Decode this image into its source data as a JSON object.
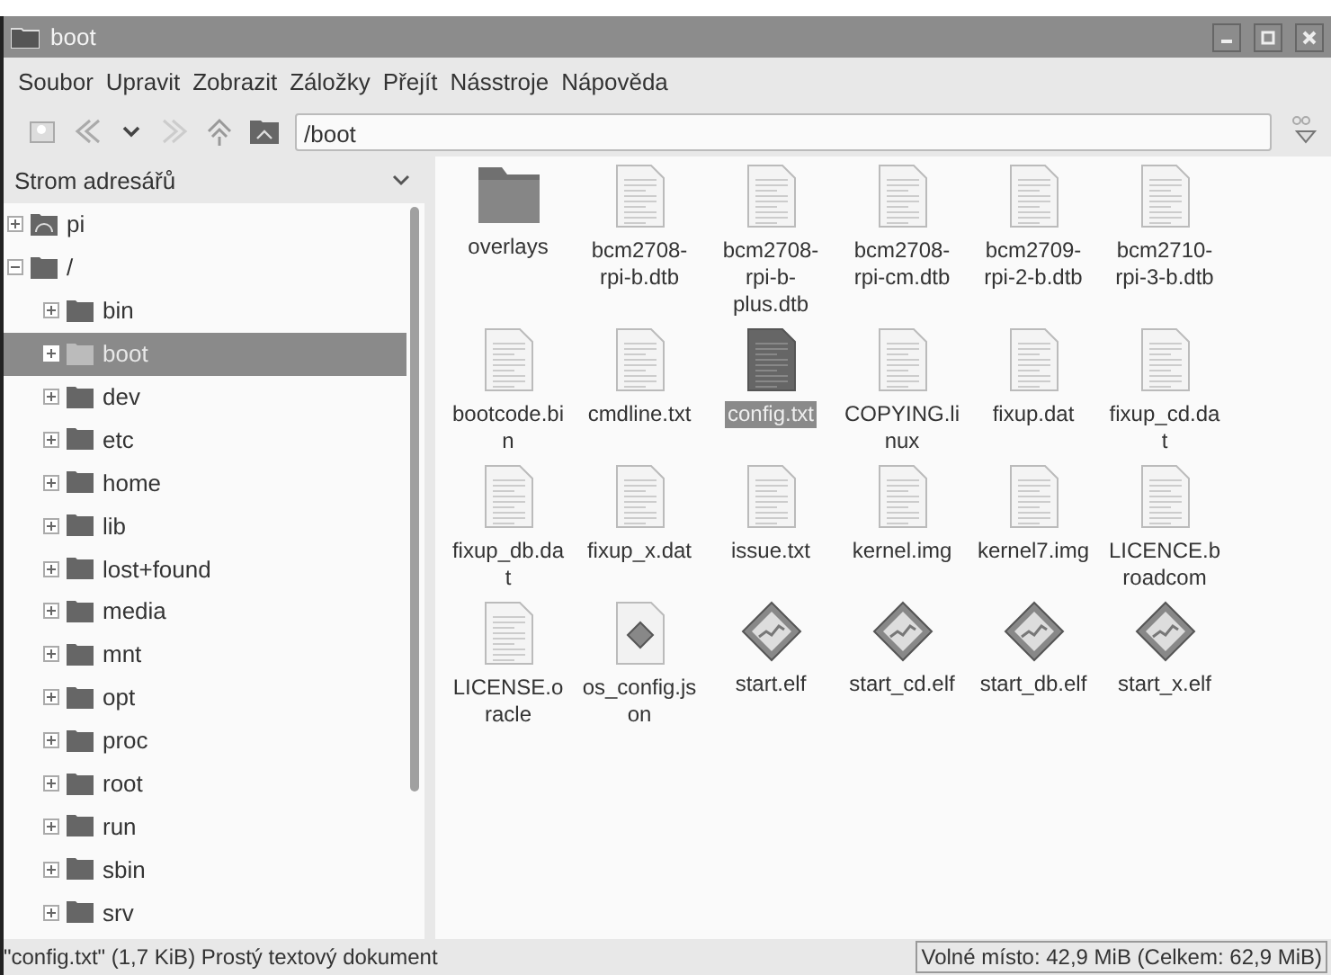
{
  "window": {
    "title": "boot"
  },
  "menu": [
    "Soubor",
    "Upravit",
    "Zobrazit",
    "Záložky",
    "Přejít",
    "Násstroje",
    "Nápověda"
  ],
  "toolbar": {
    "path": "/boot"
  },
  "sidebar": {
    "title": "Strom adresářů",
    "tree": [
      {
        "label": "pi",
        "kind": "home",
        "expanded": false,
        "selected": false
      },
      {
        "label": "/",
        "kind": "folder",
        "expanded": true,
        "selected": false,
        "children": [
          {
            "label": "bin",
            "kind": "folder",
            "expanded": false,
            "selected": false
          },
          {
            "label": "boot",
            "kind": "folder",
            "expanded": false,
            "selected": true
          },
          {
            "label": "dev",
            "kind": "folder",
            "expanded": false,
            "selected": false
          },
          {
            "label": "etc",
            "kind": "folder",
            "expanded": false,
            "selected": false
          },
          {
            "label": "home",
            "kind": "folder",
            "expanded": false,
            "selected": false
          },
          {
            "label": "lib",
            "kind": "folder",
            "expanded": false,
            "selected": false
          },
          {
            "label": "lost+found",
            "kind": "folder",
            "expanded": false,
            "selected": false
          },
          {
            "label": "media",
            "kind": "folder",
            "expanded": false,
            "selected": false
          },
          {
            "label": "mnt",
            "kind": "folder",
            "expanded": false,
            "selected": false
          },
          {
            "label": "opt",
            "kind": "folder",
            "expanded": false,
            "selected": false
          },
          {
            "label": "proc",
            "kind": "folder",
            "expanded": false,
            "selected": false
          },
          {
            "label": "root",
            "kind": "folder",
            "expanded": false,
            "selected": false
          },
          {
            "label": "run",
            "kind": "folder",
            "expanded": false,
            "selected": false
          },
          {
            "label": "sbin",
            "kind": "folder",
            "expanded": false,
            "selected": false
          },
          {
            "label": "srv",
            "kind": "folder",
            "expanded": false,
            "selected": false
          }
        ]
      }
    ]
  },
  "files": [
    {
      "name": "overlays",
      "kind": "folder",
      "selected": false
    },
    {
      "name": "bcm2708-rpi-b.dtb",
      "kind": "text",
      "selected": false
    },
    {
      "name": "bcm2708-rpi-b-plus.dtb",
      "kind": "text",
      "selected": false
    },
    {
      "name": "bcm2708-rpi-cm.dtb",
      "kind": "text",
      "selected": false
    },
    {
      "name": "bcm2709-rpi-2-b.dtb",
      "kind": "text",
      "selected": false
    },
    {
      "name": "bcm2710-rpi-3-b.dtb",
      "kind": "text",
      "selected": false
    },
    {
      "name": "bootcode.bin",
      "kind": "text",
      "selected": false
    },
    {
      "name": "cmdline.txt",
      "kind": "text",
      "selected": false
    },
    {
      "name": "config.txt",
      "kind": "text",
      "selected": true
    },
    {
      "name": "COPYING.linux",
      "kind": "text",
      "selected": false
    },
    {
      "name": "fixup.dat",
      "kind": "text",
      "selected": false
    },
    {
      "name": "fixup_cd.dat",
      "kind": "text",
      "selected": false
    },
    {
      "name": "fixup_db.dat",
      "kind": "text",
      "selected": false
    },
    {
      "name": "fixup_x.dat",
      "kind": "text",
      "selected": false
    },
    {
      "name": "issue.txt",
      "kind": "text",
      "selected": false
    },
    {
      "name": "kernel.img",
      "kind": "text",
      "selected": false
    },
    {
      "name": "kernel7.img",
      "kind": "text",
      "selected": false
    },
    {
      "name": "LICENCE.broadcom",
      "kind": "text",
      "selected": false
    },
    {
      "name": "LICENSE.oracle",
      "kind": "text",
      "selected": false
    },
    {
      "name": "os_config.json",
      "kind": "script",
      "selected": false
    },
    {
      "name": "start.elf",
      "kind": "binary",
      "selected": false
    },
    {
      "name": "start_cd.elf",
      "kind": "binary",
      "selected": false
    },
    {
      "name": "start_db.elf",
      "kind": "binary",
      "selected": false
    },
    {
      "name": "start_x.elf",
      "kind": "binary",
      "selected": false
    }
  ],
  "status_bar": {
    "info": "\"config.txt\" (1,7 KiB) Prostý textový dokument",
    "free_space": "Volné místo: 42,9 MiB (Celkem: 62,9 MiB)"
  }
}
